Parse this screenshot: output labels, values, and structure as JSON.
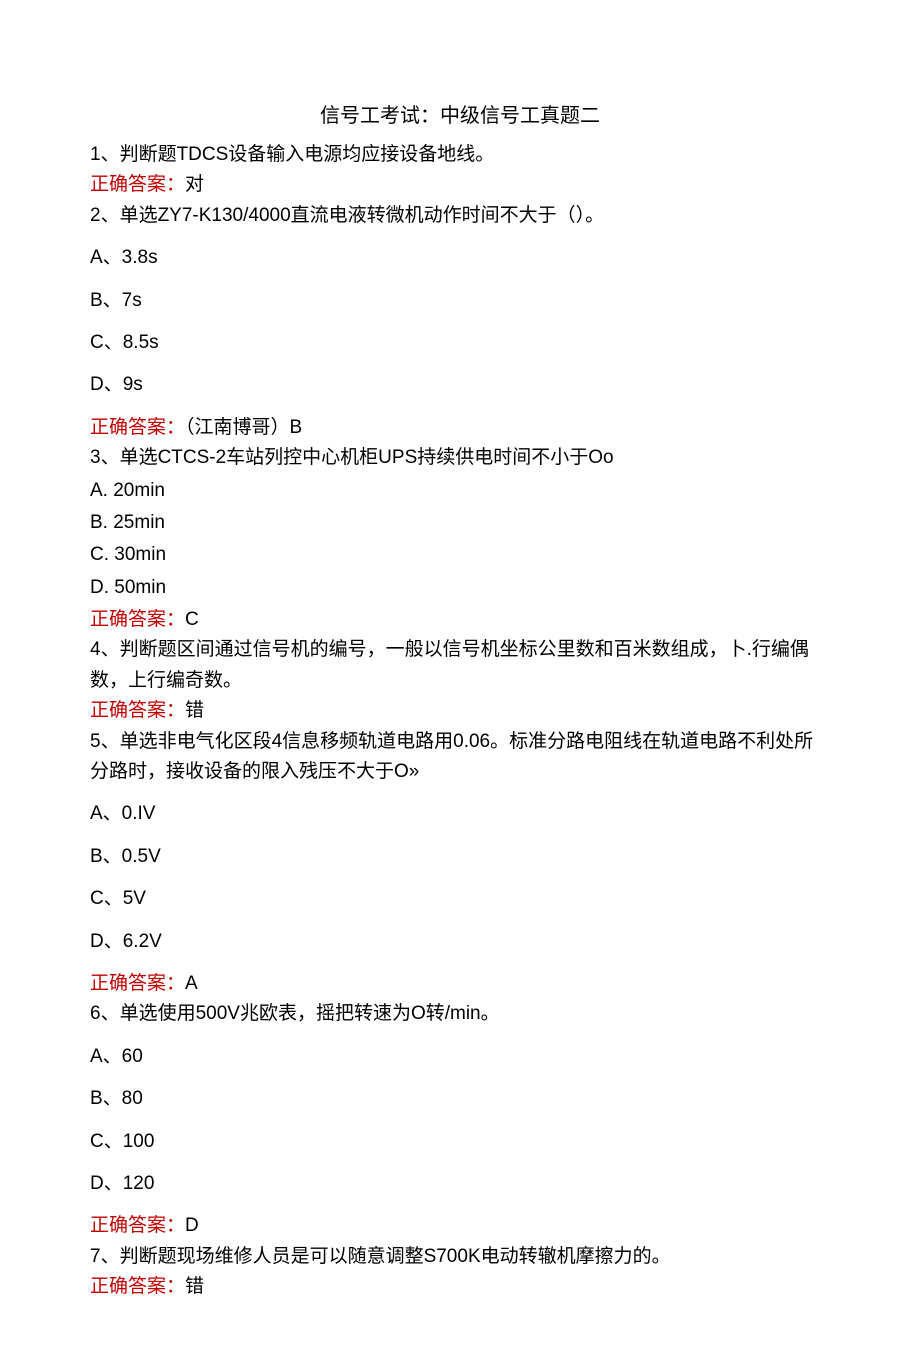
{
  "title": "信号工考试：中级信号工真题二",
  "answer_label": "正确答案：",
  "q1": {
    "text": "1、判断题TDCS设备输入电源均应接设备地线。",
    "answer": "对"
  },
  "q2": {
    "text": "2、单选ZY7-K130/4000直流电液转微机动作时间不大于（）。",
    "optA": "A、3.8s",
    "optB": "B、7s",
    "optC": "C、8.5s",
    "optD": "D、9s",
    "answer": "（江南博哥）B"
  },
  "q3": {
    "text": "3、单选CTCS-2车站列控中心机柜UPS持续供电时间不小于Oo",
    "optA": "A. 20min",
    "optB": "B. 25min",
    "optC": "C. 30min",
    "optD": "D. 50min",
    "answer": "C"
  },
  "q4": {
    "text": "4、判断题区间通过信号机的编号，一般以信号机坐标公里数和百米数组成，卜.行编偶数，上行编奇数。",
    "answer": "错"
  },
  "q5": {
    "text": "5、单选非电气化区段4信息移频轨道电路用0.06。标准分路电阻线在轨道电路不利处所分路时，接收设备的限入残压不大于O»",
    "optA": "A、0.IV",
    "optB": "B、0.5V",
    "optC": "C、5V",
    "optD": "D、6.2V",
    "answer": "A"
  },
  "q6": {
    "text": "6、单选使用500V兆欧表，摇把转速为O转/min。",
    "optA": "A、60",
    "optB": "B、80",
    "optC": "C、100",
    "optD": "D、120",
    "answer": "D"
  },
  "q7": {
    "text": "7、判断题现场维修人员是可以随意调整S700K电动转辙机摩擦力的。",
    "answer": "错"
  }
}
